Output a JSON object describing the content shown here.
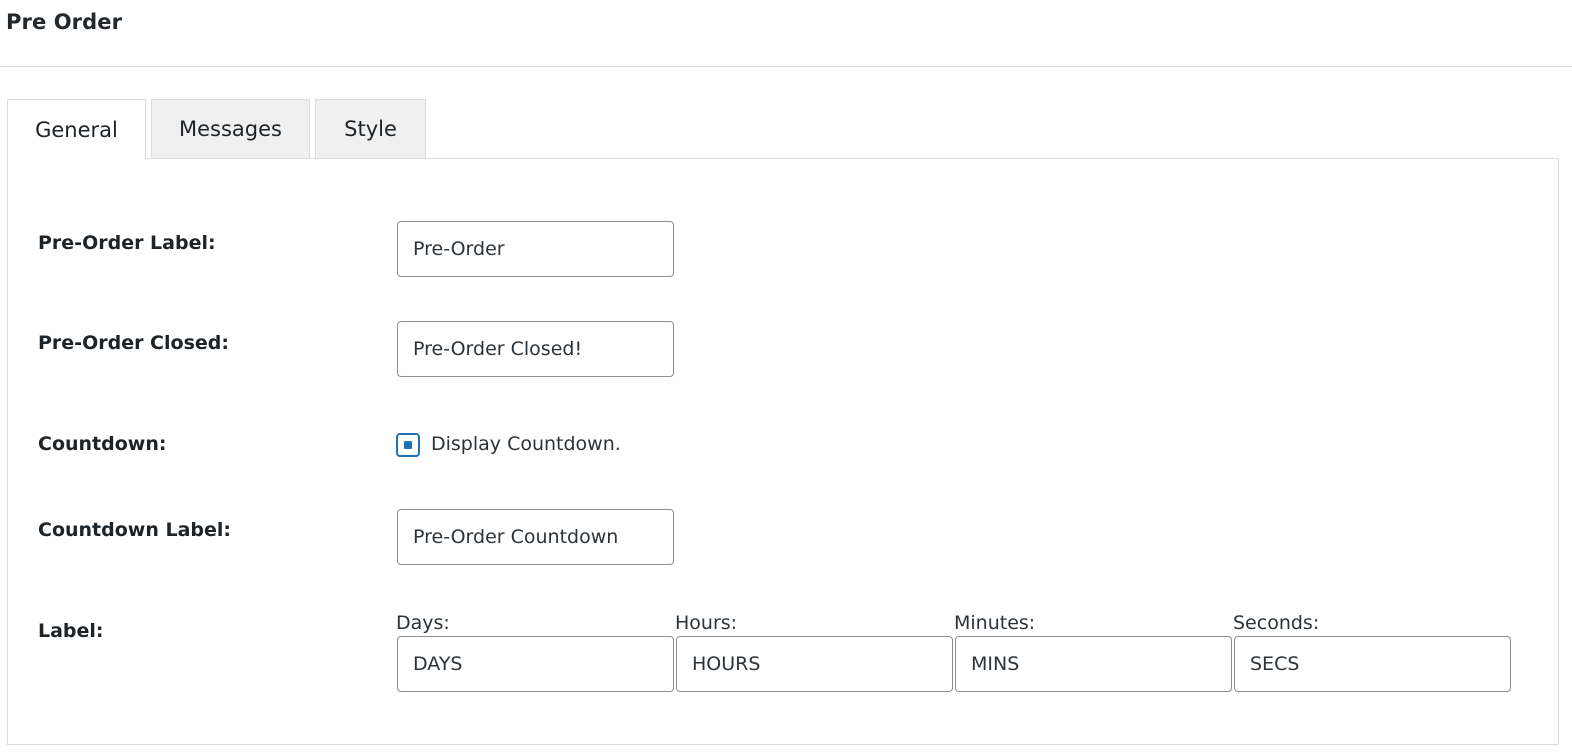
{
  "header": {
    "title": "Pre Order"
  },
  "tabs": [
    {
      "label": "General",
      "active": true
    },
    {
      "label": "Messages",
      "active": false
    },
    {
      "label": "Style",
      "active": false
    }
  ],
  "general": {
    "preorder_label": {
      "label": "Pre-Order Label:",
      "value": "Pre-Order"
    },
    "preorder_closed": {
      "label": "Pre-Order Closed:",
      "value": "Pre-Order Closed!"
    },
    "countdown": {
      "label": "Countdown:",
      "checkbox_label": "Display Countdown.",
      "checked": true
    },
    "countdown_label": {
      "label": "Countdown Label:",
      "value": "Pre-Order Countdown"
    },
    "unit_labels": {
      "label": "Label:",
      "days": {
        "label": "Days:",
        "value": "DAYS"
      },
      "hours": {
        "label": "Hours:",
        "value": "HOURS"
      },
      "minutes": {
        "label": "Minutes:",
        "value": "MINS"
      },
      "seconds": {
        "label": "Seconds:",
        "value": "SECS"
      }
    }
  },
  "colors": {
    "accent": "#2271b1",
    "border": "#dcdcde",
    "input_border": "#8c8f94",
    "tab_inactive_bg": "#f0f0f1"
  }
}
